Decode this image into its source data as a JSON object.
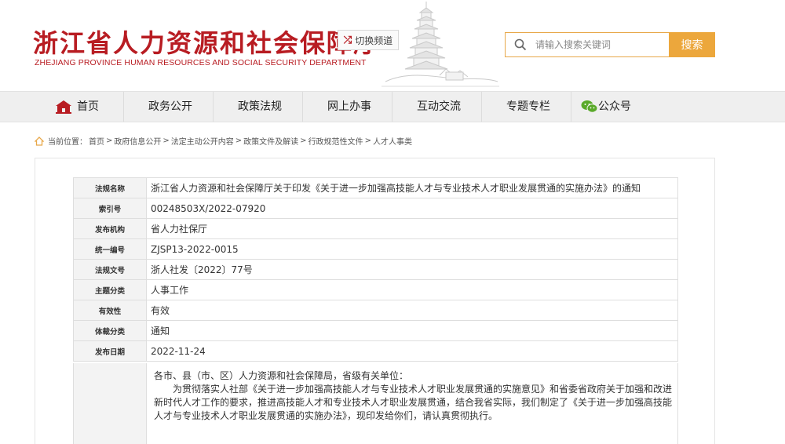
{
  "header": {
    "title": "浙江省人力资源和社会保障厅",
    "subtitle": "ZHEJIANG PROVINCE HUMAN RESOURCES AND SOCIAL SECURITY DEPARTMENT",
    "switch_label": "切换频道",
    "search_placeholder": "请输入搜索关键词",
    "search_button": "搜索",
    "accent_color": "#b81c22",
    "search_color": "#eca73c"
  },
  "nav": {
    "items": [
      {
        "label": "首页",
        "icon": "home-icon"
      },
      {
        "label": "政务公开"
      },
      {
        "label": "政策法规"
      },
      {
        "label": "网上办事"
      },
      {
        "label": "互动交流"
      },
      {
        "label": "专题专栏"
      },
      {
        "label": "公众号",
        "icon": "wechat-icon"
      }
    ]
  },
  "breadcrumb": {
    "prefix": "当前位置：",
    "items": [
      "首页",
      "政府信息公开",
      "法定主动公开内容",
      "政策文件及解读",
      "行政规范性文件",
      "人才人事类"
    ],
    "separator": ">"
  },
  "meta": {
    "rows": [
      {
        "label": "法规名称",
        "value": "浙江省人力资源和社会保障厅关于印发《关于进一步加强高技能人才与专业技术人才职业发展贯通的实施办法》的通知"
      },
      {
        "label": "索引号",
        "value": "00248503X/2022-07920"
      },
      {
        "label": "发布机构",
        "value": "省人力社保厅"
      },
      {
        "label": "统一编号",
        "value": "ZJSP13-2022-0015"
      },
      {
        "label": "法规文号",
        "value": "浙人社发〔2022〕77号"
      },
      {
        "label": "主题分类",
        "value": "人事工作"
      },
      {
        "label": "有效性",
        "value": "有效"
      },
      {
        "label": "体裁分类",
        "value": "通知"
      },
      {
        "label": "发布日期",
        "value": "2022-11-24"
      }
    ]
  },
  "content": {
    "salutation": "各市、县（市、区）人力资源和社会保障局，省级有关单位：",
    "paragraph": "为贯彻落实人社部《关于进一步加强高技能人才与专业技术人才职业发展贯通的实施意见》和省委省政府关于加强和改进新时代人才工作的要求，推进高技能人才和专业技术人才职业发展贯通，结合我省实际，我们制定了《关于进一步加强高技能人才与专业技术人才职业发展贯通的实施办法》，现印发给你们，请认真贯彻执行。"
  }
}
